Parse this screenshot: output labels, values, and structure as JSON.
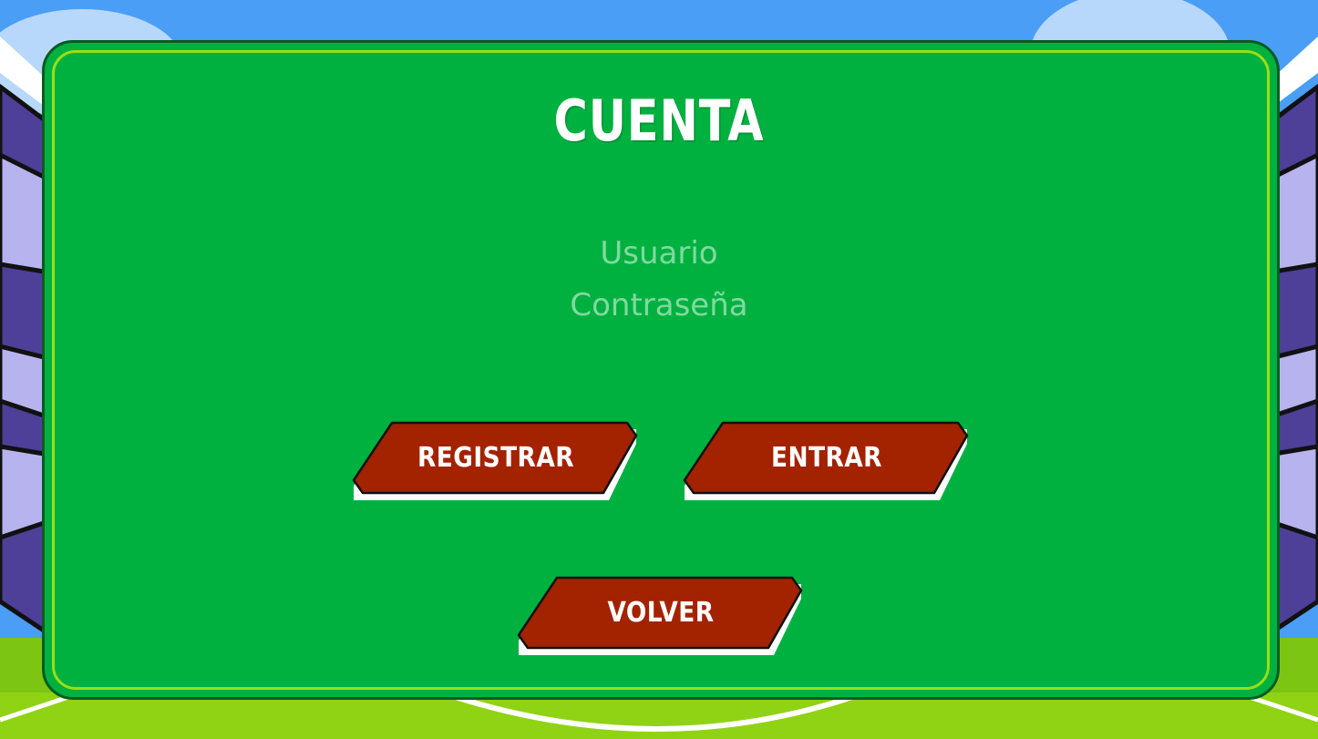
{
  "screen": {
    "title": "CUENTA"
  },
  "form": {
    "username_placeholder": "Usuario",
    "username_value": "",
    "password_placeholder": "Contraseña",
    "password_value": ""
  },
  "buttons": {
    "register_label": "REGISTRAR",
    "enter_label": "ENTRAR",
    "back_label": "VOLVER"
  },
  "colors": {
    "panel": "#00b140",
    "panel_border": "#9adf12",
    "button": "#a32200",
    "sky": "#4a9ef5",
    "pitch": "#7cc512"
  }
}
